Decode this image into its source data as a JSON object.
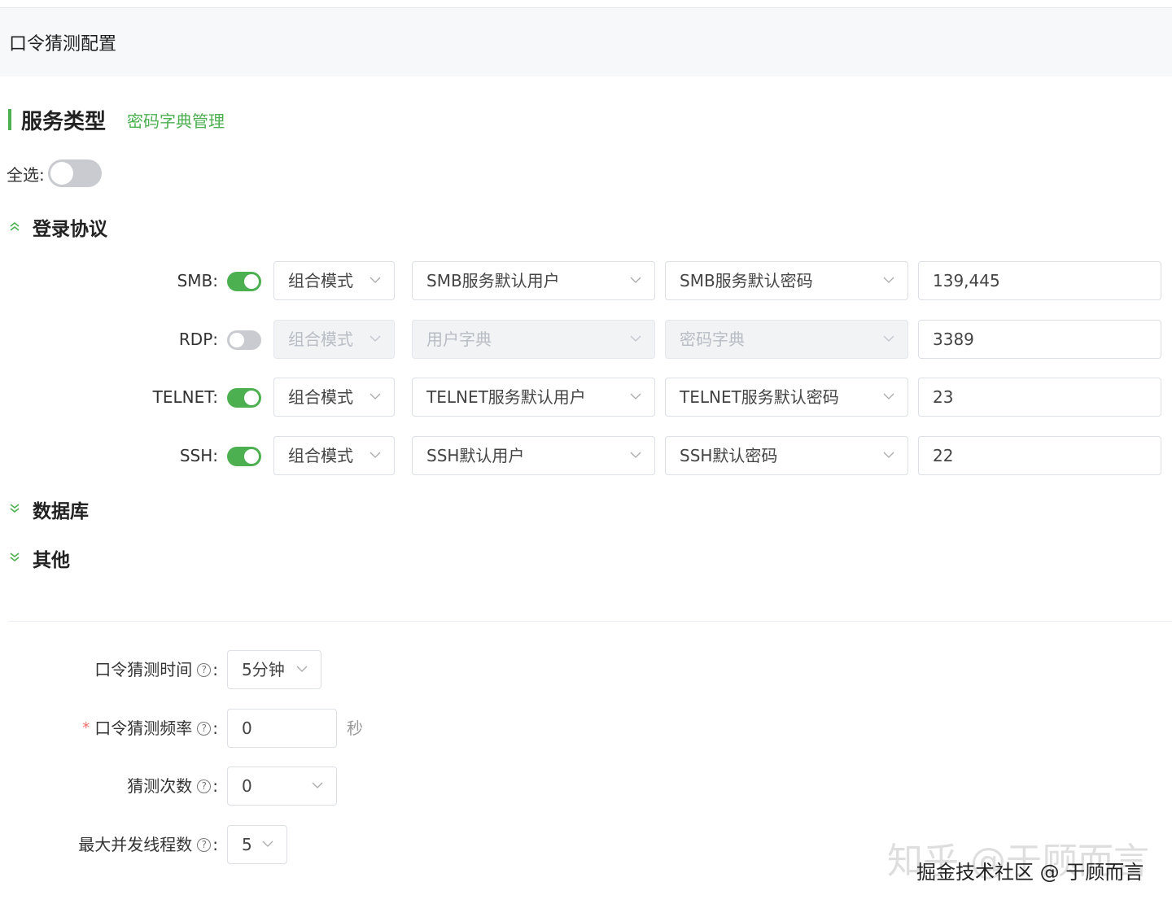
{
  "page_title": "口令猜测配置",
  "section": {
    "title": "服务类型",
    "link": "密码字典管理"
  },
  "select_all": {
    "label": "全选:",
    "on": false
  },
  "groups": {
    "login": "登录协议",
    "database": "数据库",
    "other": "其他"
  },
  "protocols": [
    {
      "label": "SMB:",
      "enabled": true,
      "mode": "组合模式",
      "user": "SMB服务默认用户",
      "pass": "SMB服务默认密码",
      "ports": "139,445"
    },
    {
      "label": "RDP:",
      "enabled": false,
      "mode": "组合模式",
      "user": "用户字典",
      "pass": "密码字典",
      "ports": "3389"
    },
    {
      "label": "TELNET:",
      "enabled": true,
      "mode": "组合模式",
      "user": "TELNET服务默认用户",
      "pass": "TELNET服务默认密码",
      "ports": "23"
    },
    {
      "label": "SSH:",
      "enabled": true,
      "mode": "组合模式",
      "user": "SSH默认用户",
      "pass": "SSH默认密码",
      "ports": "22"
    }
  ],
  "form": {
    "time": {
      "label": "口令猜测时间",
      "value": "5分钟"
    },
    "freq": {
      "label": "口令猜测频率",
      "required_mark": "*",
      "value": "0",
      "unit": "秒"
    },
    "count": {
      "label": "猜测次数",
      "value": "0"
    },
    "threads": {
      "label": "最大并发线程数",
      "value": "5"
    },
    "help_glyph": "?",
    "colon": ":"
  },
  "watermark": {
    "line1": "知乎 @于顾而言",
    "line2": "掘金技术社区 @ 于顾而言"
  },
  "colors": {
    "accent": "#4caf50",
    "required": "#f56c6c",
    "header_bg": "#f7f8fa"
  }
}
